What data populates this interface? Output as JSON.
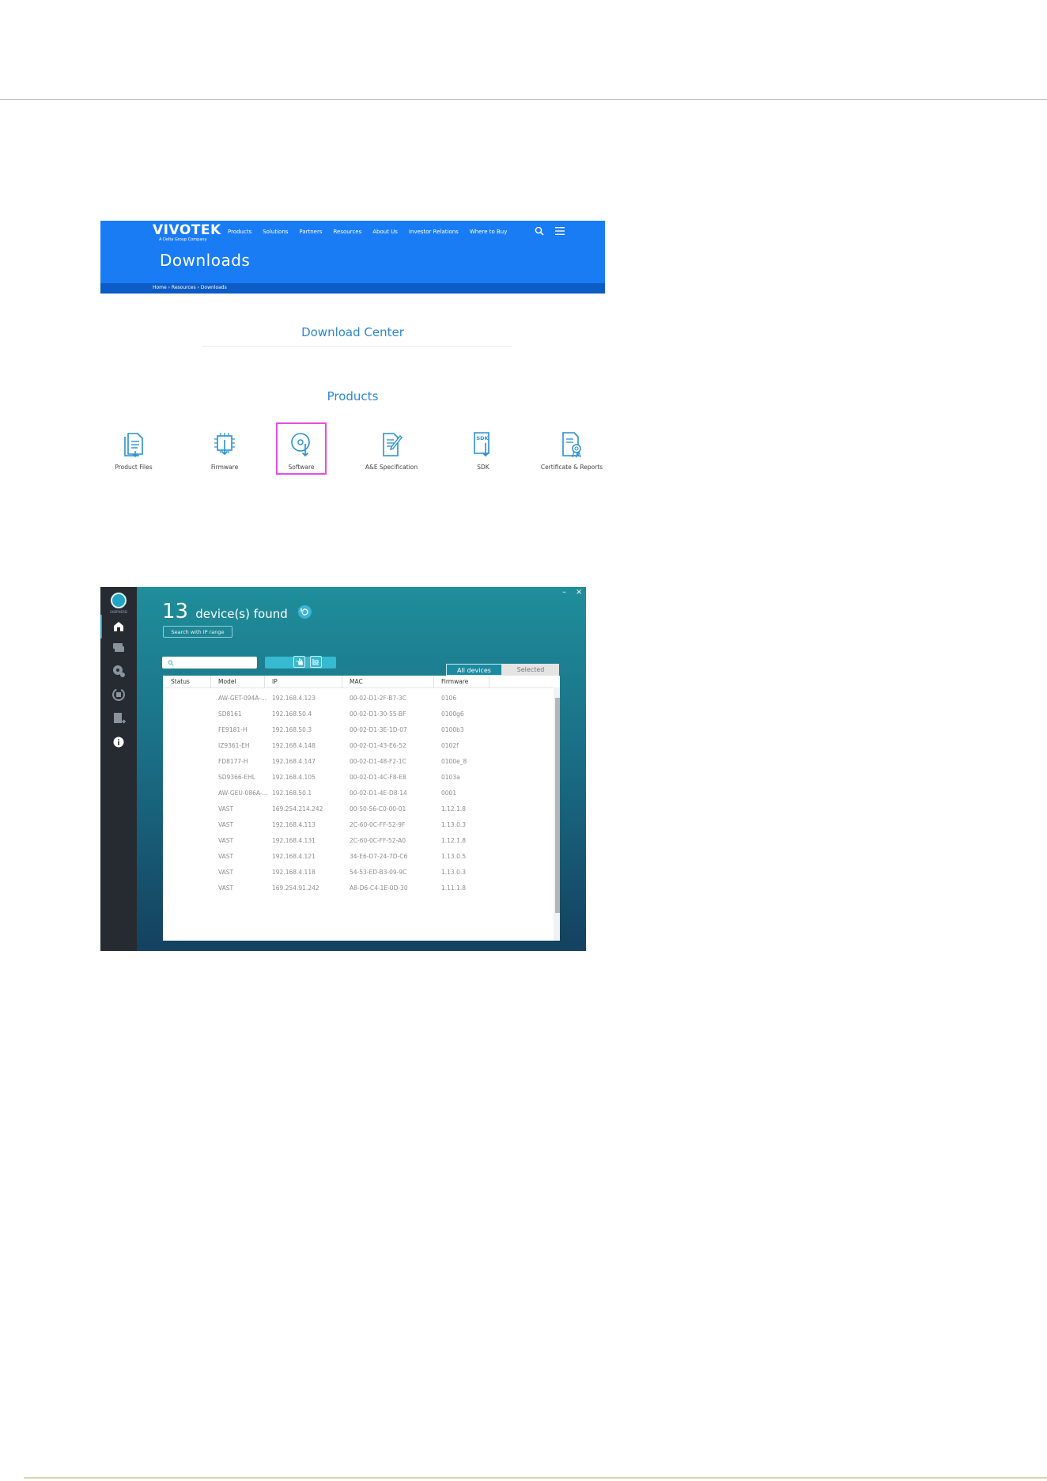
{
  "vivotek_page": {
    "brand": {
      "name": "VIVOTEK",
      "tagline": "A Delta Group Company"
    },
    "nav": [
      "Products",
      "Solutions",
      "Partners",
      "Resources",
      "About Us",
      "Investor Relations",
      "Where to Buy"
    ],
    "hero_title": "Downloads",
    "breadcrumb": "Home › Resources › Downloads",
    "download_center_title": "Download Center",
    "products_title": "Products",
    "categories": [
      {
        "label": "Product Files",
        "icon": "product-files-icon"
      },
      {
        "label": "Firmware",
        "icon": "firmware-chip-icon"
      },
      {
        "label": "Software",
        "icon": "software-disc-icon",
        "highlighted": true
      },
      {
        "label": "A&E Specification",
        "icon": "specification-pen-icon"
      },
      {
        "label": "SDK",
        "icon": "sdk-document-icon",
        "badge": "SDK"
      },
      {
        "label": "Certificate & Reports",
        "icon": "certificate-icon"
      }
    ],
    "colors": {
      "brand_blue": "#1a7cf5",
      "breadcrumb_bar": "#0d5bc4",
      "heading_blue": "#2e86d6",
      "highlight": "#e64ee0"
    }
  },
  "shepherd_app": {
    "sidebar": {
      "logo_text": "SHEPHERD",
      "items": [
        {
          "icon": "home-icon",
          "active": true
        },
        {
          "icon": "devices-stack-icon",
          "active": false
        },
        {
          "icon": "settings-gear-icon",
          "active": false
        },
        {
          "icon": "sync-update-icon",
          "active": false
        },
        {
          "icon": "export-file-icon",
          "active": false
        },
        {
          "icon": "info-icon",
          "active": false
        }
      ]
    },
    "window_controls": {
      "minimize": "–",
      "close": "×"
    },
    "device_count": "13",
    "device_label": "device(s) found",
    "ip_range_button": "Search with IP range",
    "search_placeholder": "",
    "tabs": {
      "all": "All devices",
      "selected": "Selected"
    },
    "columns": [
      "Status",
      "Model",
      "IP",
      "MAC",
      "Firmware"
    ],
    "rows": [
      {
        "status": "",
        "model": "AW-GET-094A-...",
        "ip": "192.168.4.123",
        "mac": "00-02-D1-2F-B7-3C",
        "firmware": "0106"
      },
      {
        "status": "",
        "model": "SD8161",
        "ip": "192.168.50.4",
        "mac": "00-02-D1-30-55-BF",
        "firmware": "0100g6"
      },
      {
        "status": "",
        "model": "FE9181-H",
        "ip": "192.168.50.3",
        "mac": "00-02-D1-3E-1D-07",
        "firmware": "0100b3"
      },
      {
        "status": "",
        "model": "IZ9361-EH",
        "ip": "192.168.4.148",
        "mac": "00-02-D1-43-E6-52",
        "firmware": "0102f"
      },
      {
        "status": "",
        "model": "FD8177-H",
        "ip": "192.168.4.147",
        "mac": "00-02-D1-48-F2-1C",
        "firmware": "0100e_8"
      },
      {
        "status": "",
        "model": "SD9366-EHL",
        "ip": "192.168.4.105",
        "mac": "00-02-D1-4C-F8-E8",
        "firmware": "0103a"
      },
      {
        "status": "",
        "model": "AW-GEU-086A-...",
        "ip": "192.168.50.1",
        "mac": "00-02-D1-4E-D8-14",
        "firmware": "0001"
      },
      {
        "status": "",
        "model": "VAST",
        "ip": "169.254.214.242",
        "mac": "00-50-56-C0-00-01",
        "firmware": "1.12.1.8"
      },
      {
        "status": "",
        "model": "VAST",
        "ip": "192.168.4.113",
        "mac": "2C-60-0C-FF-52-9F",
        "firmware": "1.13.0.3"
      },
      {
        "status": "",
        "model": "VAST",
        "ip": "192.168.4.131",
        "mac": "2C-60-0C-FF-52-A0",
        "firmware": "1.12.1.8"
      },
      {
        "status": "",
        "model": "VAST",
        "ip": "192.168.4.121",
        "mac": "34-E6-D7-24-7D-C6",
        "firmware": "1.13.0.5"
      },
      {
        "status": "",
        "model": "VAST",
        "ip": "192.168.4.118",
        "mac": "54-53-ED-B3-09-9C",
        "firmware": "1.13.0.3"
      },
      {
        "status": "",
        "model": "VAST",
        "ip": "169.254.91.242",
        "mac": "A8-D6-C4-1E-0D-30",
        "firmware": "1.11.1.8"
      }
    ],
    "colors": {
      "gradient_top": "#1f8e9b",
      "gradient_bottom": "#14415f",
      "sidebar": "#262b31",
      "accent": "#37b9d0"
    }
  }
}
